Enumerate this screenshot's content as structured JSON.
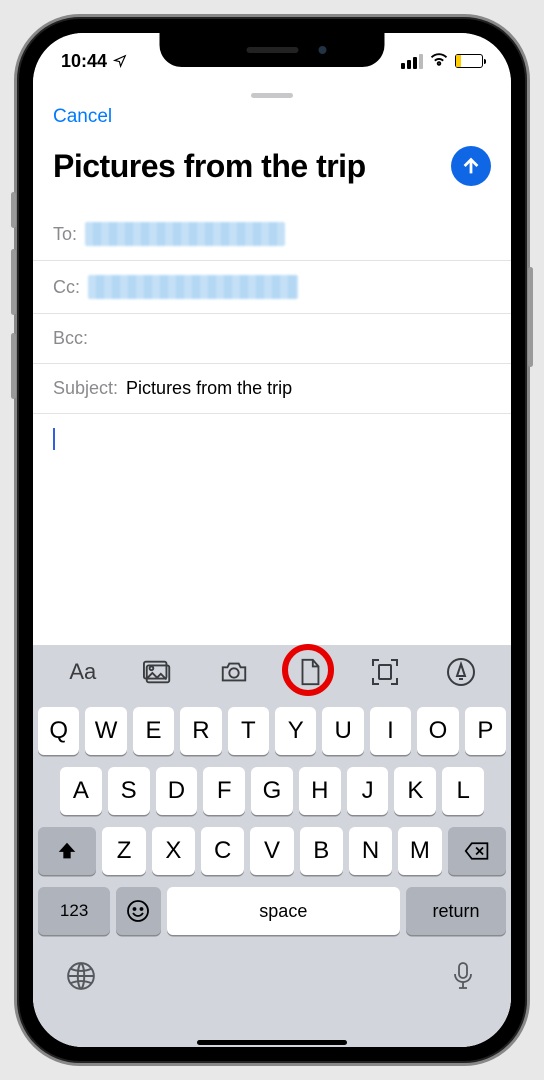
{
  "status": {
    "time": "10:44",
    "location_glyph": "➤"
  },
  "sheet": {
    "cancel": "Cancel",
    "title": "Pictures from the trip",
    "fields": {
      "to_label": "To:",
      "cc_label": "Cc:",
      "bcc_label": "Bcc:",
      "subject_label": "Subject:",
      "subject_value": "Pictures from the trip"
    }
  },
  "accessory": {
    "format": "Aa",
    "photos": "photos-icon",
    "camera": "camera-icon",
    "document": "document-icon",
    "scan": "scan-icon",
    "markup": "markup-icon"
  },
  "keyboard": {
    "row1": [
      "Q",
      "W",
      "E",
      "R",
      "T",
      "Y",
      "U",
      "I",
      "O",
      "P"
    ],
    "row2": [
      "A",
      "S",
      "D",
      "F",
      "G",
      "H",
      "J",
      "K",
      "L"
    ],
    "row3": [
      "Z",
      "X",
      "C",
      "V",
      "B",
      "N",
      "M"
    ],
    "k123": "123",
    "space": "space",
    "return": "return"
  }
}
